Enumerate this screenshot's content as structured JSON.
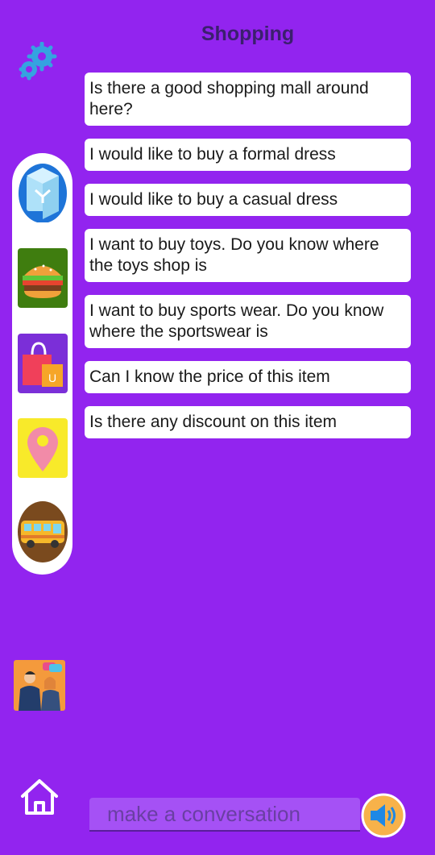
{
  "header": {
    "title": "Shopping"
  },
  "icons": {
    "settings": "gear-icon",
    "home": "home-icon",
    "speaker": "speaker-icon"
  },
  "categories": [
    {
      "name": "gift-box-icon"
    },
    {
      "name": "burger-icon"
    },
    {
      "name": "shopping-bag-icon"
    },
    {
      "name": "location-pin-icon"
    },
    {
      "name": "bus-icon"
    }
  ],
  "messages": [
    "Is there a good shopping mall around here?",
    "I would like to buy a formal dress",
    "I would like to buy a casual dress",
    "I want to buy toys. Do you know where the toys shop is",
    "I want to buy sports wear. Do you know where the sportswear is",
    "Can I know the price of this item",
    "Is there any discount on this item"
  ],
  "input": {
    "placeholder": "make a conversation",
    "value": ""
  },
  "colors": {
    "background": "#9224ef",
    "bubble": "#ffffff",
    "title": "#3b1f6e",
    "speaker_bg": "#f7b24a",
    "speaker_fg": "#1e88e5"
  }
}
